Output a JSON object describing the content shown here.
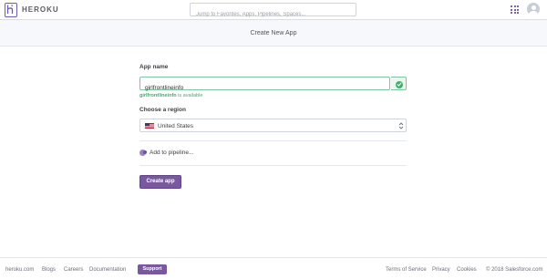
{
  "header": {
    "brand": "HEROKU",
    "search_placeholder": "Jump to Favorites, Apps, Pipelines, Spaces...",
    "apps_icon": "grid-icon",
    "avatar_icon": "user-avatar-icon"
  },
  "subheader": {
    "title": "Create New App"
  },
  "form": {
    "app_name_label": "App name",
    "app_name_value": "girlfrontlineinfo",
    "availability_name": "girlfrontlineinfo",
    "availability_suffix": " is available",
    "region_label": "Choose a region",
    "region_value": "United States",
    "pipeline_label": "Add to pipeline...",
    "create_button": "Create app"
  },
  "footer": {
    "links": [
      "heroku.com",
      "Blogs",
      "Careers",
      "Documentation"
    ],
    "support": "Support",
    "right_links": [
      "Terms of Service",
      "Privacy",
      "Cookies"
    ],
    "copyright": "© 2018 Salesforce.com"
  },
  "colors": {
    "accent": "#79589f",
    "success": "#3fae6b"
  }
}
